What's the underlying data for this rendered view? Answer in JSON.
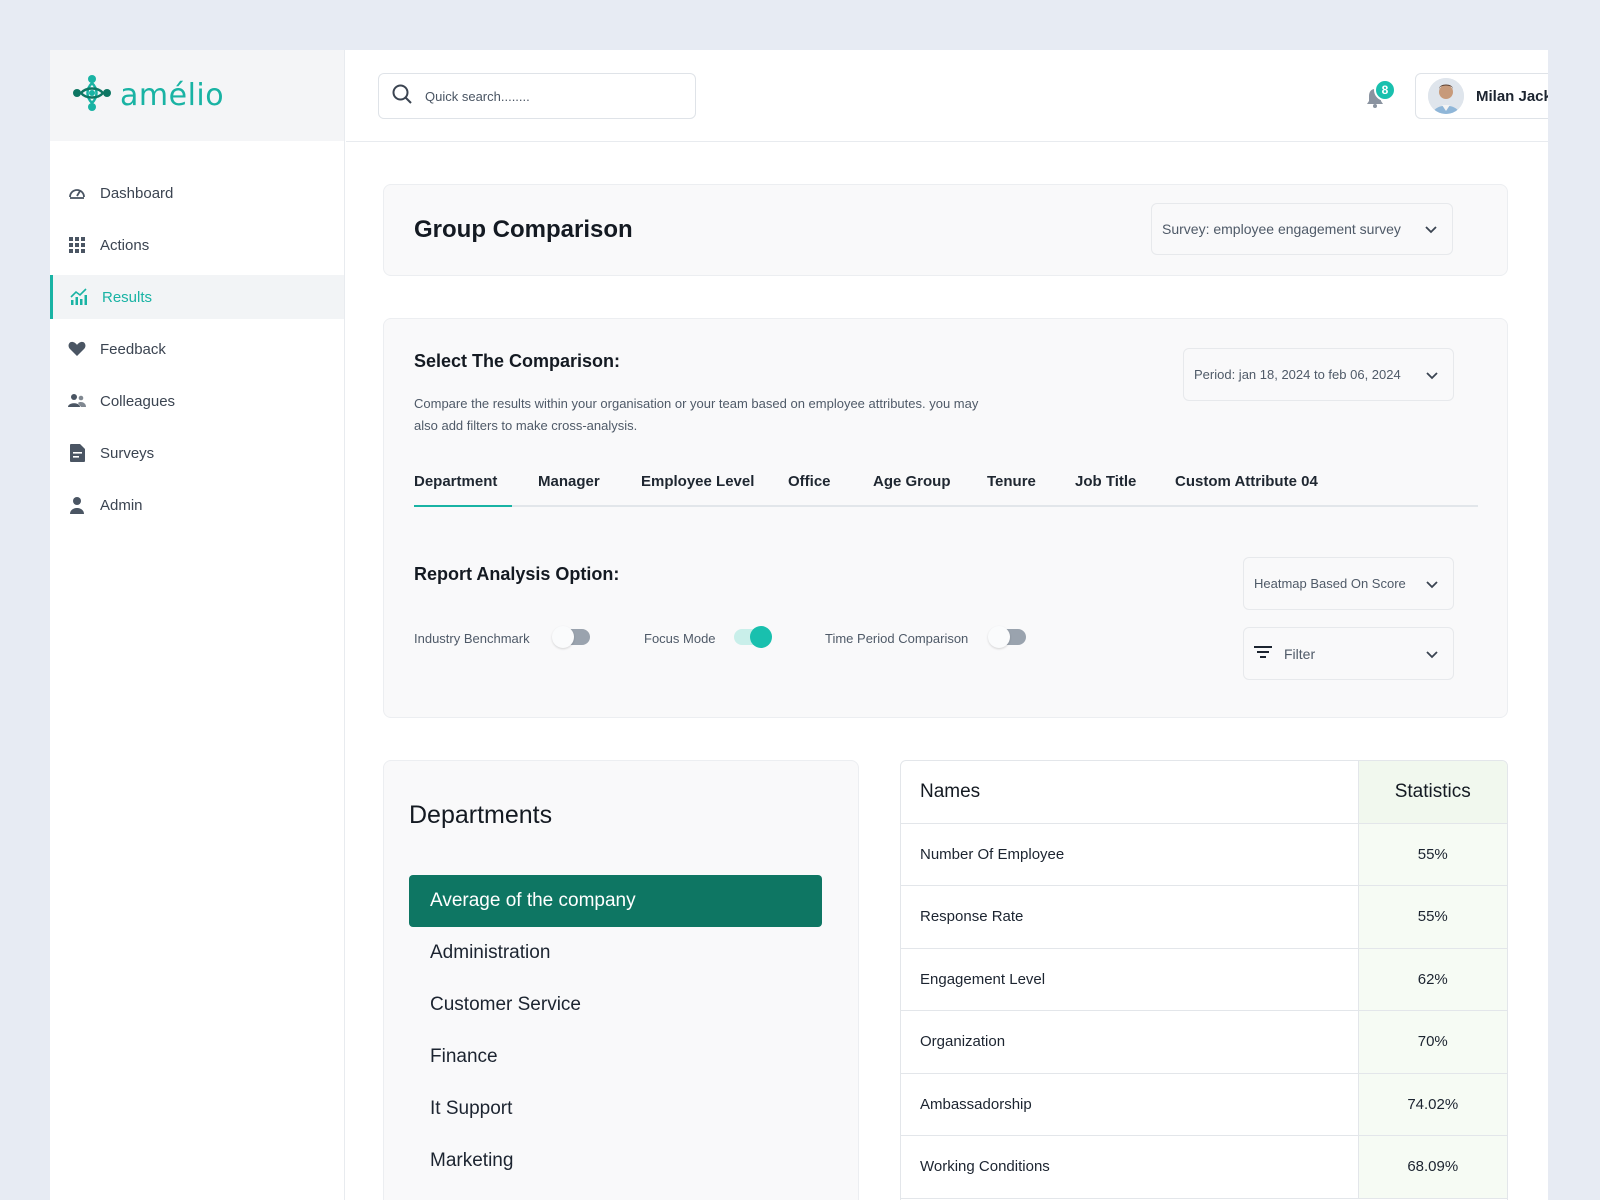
{
  "brand": {
    "name": "amélio",
    "color": "#19b3a4"
  },
  "sidebar": {
    "items": [
      {
        "label": "Dashboard",
        "icon": "gauge-icon",
        "active": false
      },
      {
        "label": "Actions",
        "icon": "grid-icon",
        "active": false
      },
      {
        "label": "Results",
        "icon": "chart-icon",
        "active": true
      },
      {
        "label": "Feedback",
        "icon": "heart-icon",
        "active": false
      },
      {
        "label": "Colleagues",
        "icon": "users-icon",
        "active": false
      },
      {
        "label": "Surveys",
        "icon": "document-icon",
        "active": false
      },
      {
        "label": "Admin",
        "icon": "user-icon",
        "active": false
      }
    ]
  },
  "header": {
    "search_placeholder": "Quick search........",
    "notification_count": "8",
    "user_name": "Milan Jack"
  },
  "page": {
    "title": "Group Comparison",
    "survey_select": "Survey: employee engagement survey"
  },
  "comparison": {
    "title": "Select The Comparison:",
    "description": "Compare the results within your organisation or your team based on employee attributes. you may also add filters to make cross-analysis.",
    "period_select": "Period: jan 18, 2024 to feb 06, 2024",
    "tabs": [
      "Department",
      "Manager",
      "Employee Level",
      "Office",
      "Age Group",
      "Tenure",
      "Job Title",
      "Custom Attribute 04"
    ],
    "active_tab": "Department"
  },
  "report": {
    "title": "Report Analysis Option:",
    "toggles": [
      {
        "label": "Industry Benchmark",
        "on": false
      },
      {
        "label": "Focus Mode",
        "on": true
      },
      {
        "label": "Time Period Comparison",
        "on": false
      }
    ],
    "heatmap_select": "Heatmap Based On Score",
    "filter_label": "Filter"
  },
  "departments": {
    "title": "Departments",
    "items": [
      "Average of the company",
      "Administration",
      "Customer Service",
      "Finance",
      "It Support",
      "Marketing"
    ],
    "active": "Average of the company"
  },
  "stats_table": {
    "headers": [
      "Names",
      "Statistics"
    ],
    "rows": [
      {
        "name": "Number Of Employee",
        "value": "55%"
      },
      {
        "name": "Response Rate",
        "value": "55%"
      },
      {
        "name": "Engagement Level",
        "value": "62%"
      },
      {
        "name": "Organization",
        "value": "70%"
      },
      {
        "name": "Ambassadorship",
        "value": "74.02%"
      },
      {
        "name": "Working Conditions",
        "value": "68.09%"
      }
    ]
  },
  "colors": {
    "accent": "#19b3a4",
    "active_department": "#0e7663",
    "toggle_on": "#19c0ae",
    "statistics_column": "#f6fbf4"
  }
}
